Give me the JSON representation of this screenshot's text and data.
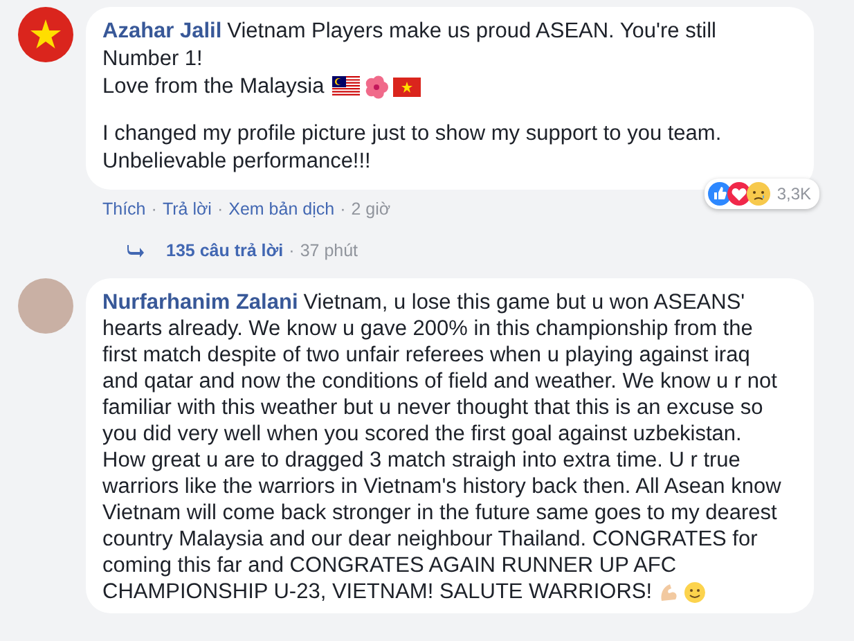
{
  "comments": [
    {
      "author": "Azahar Jalil",
      "avatar": {
        "kind": "flag"
      },
      "paragraphs": [
        {
          "lines": [
            {
              "kind": "plain",
              "text": "Vietnam Players make us proud ASEAN. You're still Number 1!"
            },
            {
              "kind": "flags",
              "text": "Love from the Malaysia"
            }
          ]
        },
        {
          "lines": [
            {
              "kind": "plain",
              "text": "I changed my profile picture just to show my support to you team. Unbelievable performance!!!"
            }
          ]
        }
      ],
      "actions": [
        "Thích",
        "Trả lời",
        "Xem bản dịch"
      ],
      "separator": "·",
      "time": "2 giờ",
      "reactions": {
        "count": "3,3K"
      },
      "replies": {
        "count": "135 câu trả lời",
        "time": "37 phút"
      }
    },
    {
      "author": "Nurfarhanim Zalani",
      "avatar": {
        "kind": "photo"
      },
      "paragraphs": [
        {
          "lines": [
            {
              "kind": "salute",
              "text": "Vietnam, u lose this game but u won ASEANS' hearts already. We know u gave 200% in this championship from the first match despite of two unfair referees when u playing against iraq and qatar and now the conditions of field and weather. We know u r not familiar with this weather but u never thought that this is an excuse so you did very well when you scored the first goal against uzbekistan. How great u are to dragged 3 match straigh into extra time. U r true warriors like the warriors in Vietnam's history back then. All Asean know Vietnam will come back stronger in the future same goes to my dearest country Malaysia and our dear neighbour Thailand. CONGRATES for coming this far and CONGRATES AGAIN RUNNER UP AFC CHAMPIONSHIP U-23, VIETNAM! SALUTE WARRIORS!"
            }
          ]
        }
      ]
    }
  ]
}
